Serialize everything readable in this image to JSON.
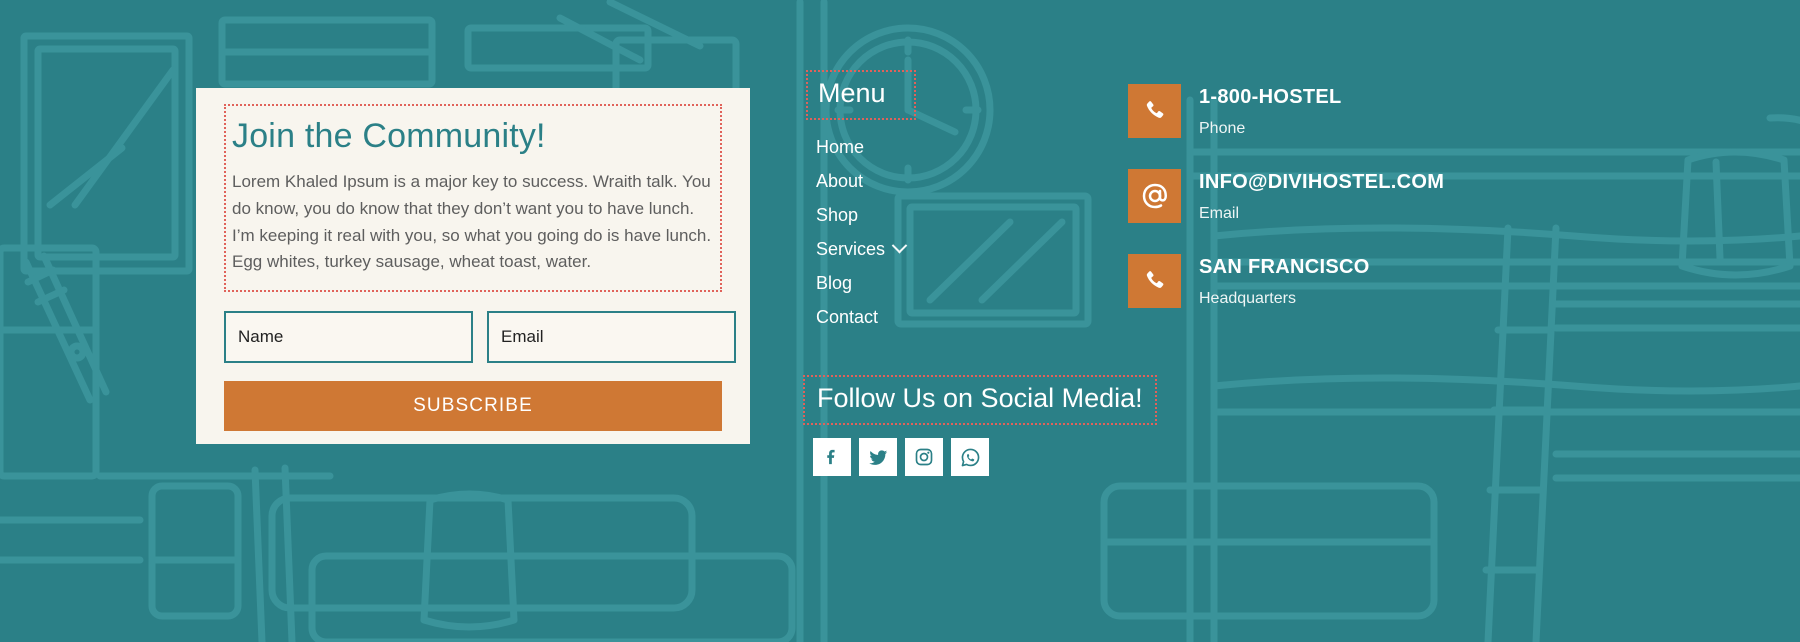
{
  "theme": {
    "bg_teal": "#2b8087",
    "bg_line": "#3a939a",
    "card_cream": "#f8f5ee",
    "accent_orange": "#cf7834",
    "dotted_red": "#e0625a",
    "heading_teal": "#2b8087",
    "text_white": "#ffffff"
  },
  "signup": {
    "title": "Join the Community!",
    "description": "Lorem Khaled Ipsum is a major key to success. Wraith talk. You do know, you do know that they don’t want you to have lunch. I’m keeping it real with you, so what you going do is have lunch. Egg whites, turkey sausage, wheat toast, water.",
    "name_placeholder": "Name",
    "name_value": "",
    "email_placeholder": "Email",
    "email_value": "",
    "subscribe_label": "SUBSCRIBE"
  },
  "menu": {
    "heading": "Menu",
    "items": [
      {
        "label": "Home",
        "has_dropdown": false,
        "icon": ""
      },
      {
        "label": "About",
        "has_dropdown": false,
        "icon": ""
      },
      {
        "label": "Shop",
        "has_dropdown": false,
        "icon": ""
      },
      {
        "label": "Services",
        "has_dropdown": true,
        "icon": "chevron-down-icon"
      },
      {
        "label": "Blog",
        "has_dropdown": false,
        "icon": ""
      },
      {
        "label": "Contact",
        "has_dropdown": false,
        "icon": ""
      }
    ]
  },
  "social": {
    "heading": "Follow Us on Social Media!",
    "icons": [
      {
        "name": "facebook-icon",
        "label": "Facebook"
      },
      {
        "name": "twitter-icon",
        "label": "Twitter"
      },
      {
        "name": "instagram-icon",
        "label": "Instagram"
      },
      {
        "name": "whatsapp-icon",
        "label": "WhatsApp"
      }
    ]
  },
  "contacts": [
    {
      "icon": "phone-icon",
      "title": "1-800-HOSTEL",
      "subtitle": "Phone"
    },
    {
      "icon": "at-sign-icon",
      "title": "INFO@DIVIHOSTEL.COM",
      "subtitle": "Email"
    },
    {
      "icon": "phone-icon",
      "title": "SAN FRANCISCO",
      "subtitle": "Headquarters"
    }
  ],
  "background": {
    "description": "hostel line-art illustration: picture frame, wall clock, bunk beds, ladder, sofa, lamp"
  }
}
